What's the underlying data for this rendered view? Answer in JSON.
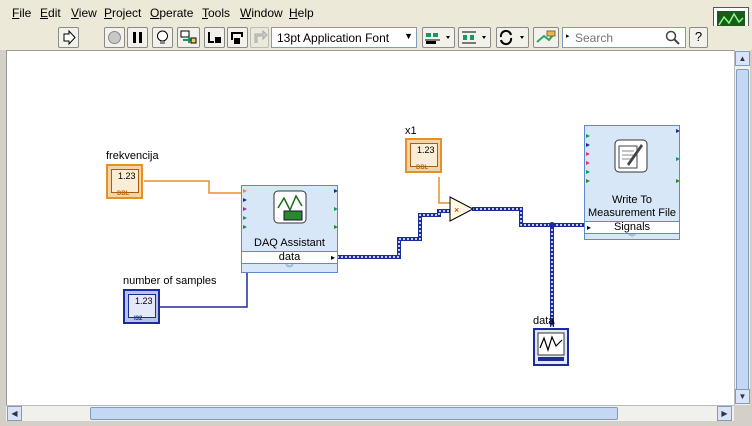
{
  "menu": {
    "file": "File",
    "edit": "Edit",
    "view": "View",
    "project": "Project",
    "operate": "Operate",
    "tools": "Tools",
    "window": "Window",
    "help": "Help"
  },
  "toolbar": {
    "font_select_value": "13pt Application Font",
    "search_placeholder": "Search",
    "help_label": "?"
  },
  "diagram": {
    "frekvencija": {
      "label": "frekvencija",
      "value": "1.23",
      "type": "DBL"
    },
    "x1": {
      "label": "x1",
      "value": "1.23",
      "type": "DBL"
    },
    "number_of_samples": {
      "label": "number of samples",
      "value": "1.23",
      "type": "I32"
    },
    "daq_assistant": {
      "title": "DAQ Assistant",
      "output": "data"
    },
    "write_file": {
      "title_line1": "Write To",
      "title_line2": "Measurement File",
      "input": "Signals"
    },
    "graph_label": "data",
    "multiply_symbol": "×"
  },
  "colors": {
    "dbl_orange": "#e88f28",
    "i32_blue": "#1a2b9a",
    "dynamic_wire": "#1a2b9a",
    "express_fill": "#d8e7f7"
  }
}
